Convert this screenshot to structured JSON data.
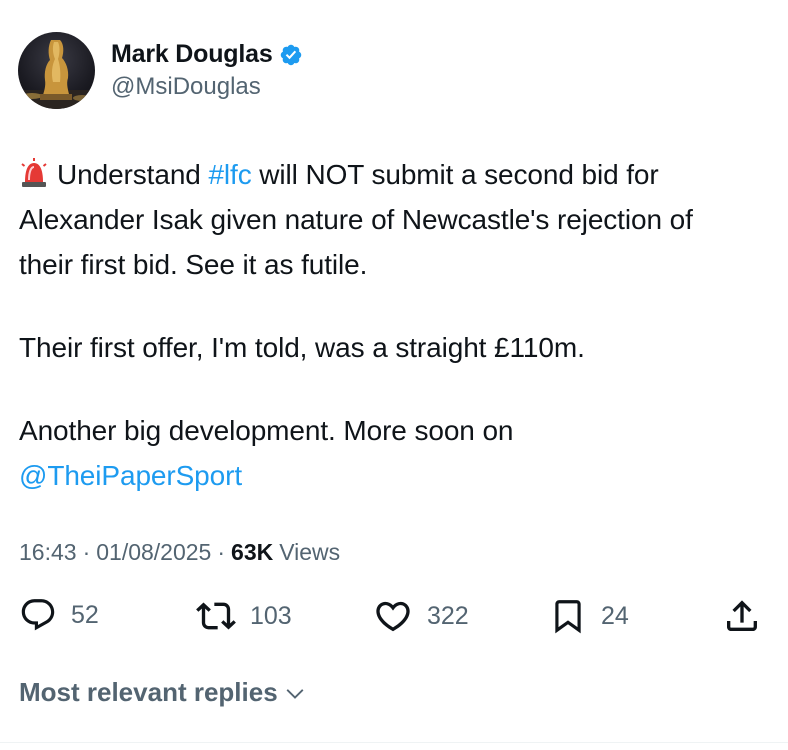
{
  "author": {
    "display_name": "Mark Douglas",
    "handle": "@MsiDouglas",
    "avatar_icon": "statue-avatar",
    "verified_icon": "verified-badge-icon",
    "verified_color": "#1d9bf0"
  },
  "tweet": {
    "emoji_icon": "police-siren-emoji",
    "p1_pre": "Understand ",
    "p1_hashtag": "#lfc",
    "p1_line1_post": " will NOT submit a second bid for",
    "p1_line2": "Alexander Isak given nature of Newcastle's rejection of",
    "p1_line3": "their first bid. See it as futile.",
    "p2": "Their first offer, I'm told, was a straight £110m.",
    "p3_line1": "Another big development. More soon on",
    "p3_mention": "@TheiPaperSport",
    "link_color": "#1d9bf0"
  },
  "meta": {
    "time": "16:43",
    "separator": "·",
    "date": "01/08/2025",
    "views_count": "63K",
    "views_label": "Views"
  },
  "actions": {
    "replies": "52",
    "reposts": "103",
    "likes": "322",
    "bookmarks": "24"
  },
  "footer": {
    "replies_sort_label": "Most relevant replies"
  }
}
